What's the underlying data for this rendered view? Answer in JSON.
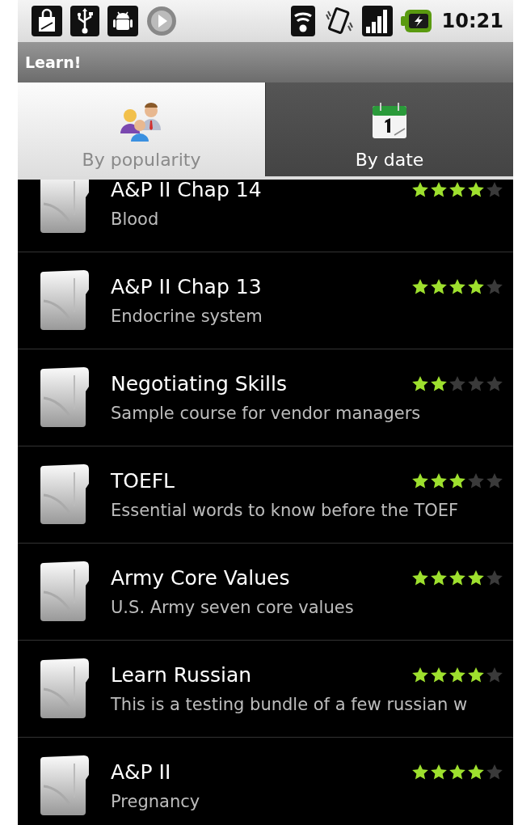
{
  "status_bar": {
    "time": "10:21"
  },
  "title_bar": {
    "title": "Learn!"
  },
  "tabs": [
    {
      "label": "By popularity",
      "selected": true
    },
    {
      "label": "By date",
      "selected": false
    }
  ],
  "courses": [
    {
      "title": "A&P II Chap 14",
      "subtitle": "Blood",
      "stars": 4
    },
    {
      "title": "A&P II Chap 13",
      "subtitle": "Endocrine system",
      "stars": 4
    },
    {
      "title": "Negotiating Skills",
      "subtitle": "Sample course for vendor managers",
      "stars": 2
    },
    {
      "title": "TOEFL",
      "subtitle": "Essential words to know before the TOEF",
      "stars": 3
    },
    {
      "title": "Army Core Values",
      "subtitle": "U.S. Army seven core values",
      "stars": 4
    },
    {
      "title": "Learn Russian",
      "subtitle": "This is a testing bundle of a few russian w",
      "stars": 4
    },
    {
      "title": "A&P II",
      "subtitle": "Pregnancy",
      "stars": 4
    }
  ]
}
